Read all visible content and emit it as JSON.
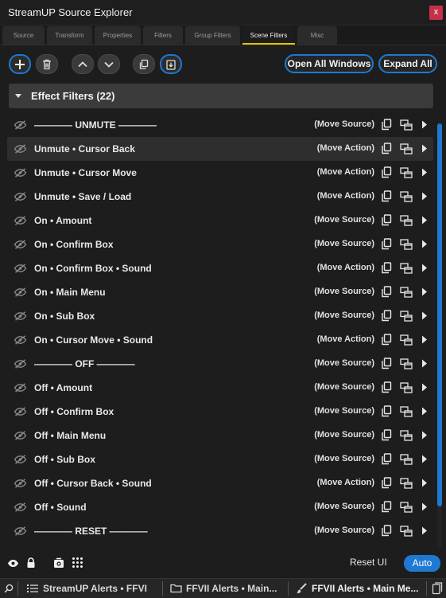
{
  "window": {
    "title": "StreamUP Source Explorer",
    "close_label": "x"
  },
  "tabs": [
    {
      "label": "Source"
    },
    {
      "label": "Transform"
    },
    {
      "label": "Properties"
    },
    {
      "label": "Filters"
    },
    {
      "label": "Group Filters"
    },
    {
      "label": "Scene Filters"
    },
    {
      "label": "Misc"
    }
  ],
  "active_tab": "Scene Filters",
  "toolbar": {
    "open_all_windows_label": "Open All Windows",
    "expand_all_label": "Expand All"
  },
  "group": {
    "label": "Effect Filters (22)"
  },
  "rows": [
    {
      "name": "———— UNMUTE ————",
      "type": "(Move Source)",
      "separator": true
    },
    {
      "name": "Unmute • Cursor Back",
      "type": "(Move Action)",
      "selected": true
    },
    {
      "name": "Unmute • Cursor Move",
      "type": "(Move Action)"
    },
    {
      "name": "Unmute • Save / Load",
      "type": "(Move Action)"
    },
    {
      "name": "On • Amount",
      "type": "(Move Source)"
    },
    {
      "name": "On • Confirm Box",
      "type": "(Move Source)"
    },
    {
      "name": "On • Confirm Box • Sound",
      "type": "(Move Action)"
    },
    {
      "name": "On • Main Menu",
      "type": "(Move Source)"
    },
    {
      "name": "On • Sub Box",
      "type": "(Move Source)"
    },
    {
      "name": "On • Cursor Move • Sound",
      "type": "(Move Action)"
    },
    {
      "name": "———— OFF ————",
      "type": "(Move Source)",
      "separator": true
    },
    {
      "name": "Off • Amount",
      "type": "(Move Source)"
    },
    {
      "name": "Off • Confirm Box",
      "type": "(Move Source)"
    },
    {
      "name": "Off • Main Menu",
      "type": "(Move Source)"
    },
    {
      "name": "Off • Sub Box",
      "type": "(Move Source)"
    },
    {
      "name": "Off • Cursor Back • Sound",
      "type": "(Move Action)"
    },
    {
      "name": "Off • Sound",
      "type": "(Move Source)"
    },
    {
      "name": "———— RESET ————",
      "type": "(Move Source)",
      "separator": true
    }
  ],
  "bottom": {
    "reset_label": "Reset UI",
    "auto_label": "Auto"
  },
  "taskbar": [
    {
      "label": "StreamUP Alerts • FFVI"
    },
    {
      "label": "FFVII Alerts • Main..."
    },
    {
      "label": "FFVII Alerts • Main Me..."
    }
  ],
  "colors": {
    "accent": "#1f78d1",
    "active_tab_underline": "#e6c200",
    "close": "#c4314b"
  }
}
